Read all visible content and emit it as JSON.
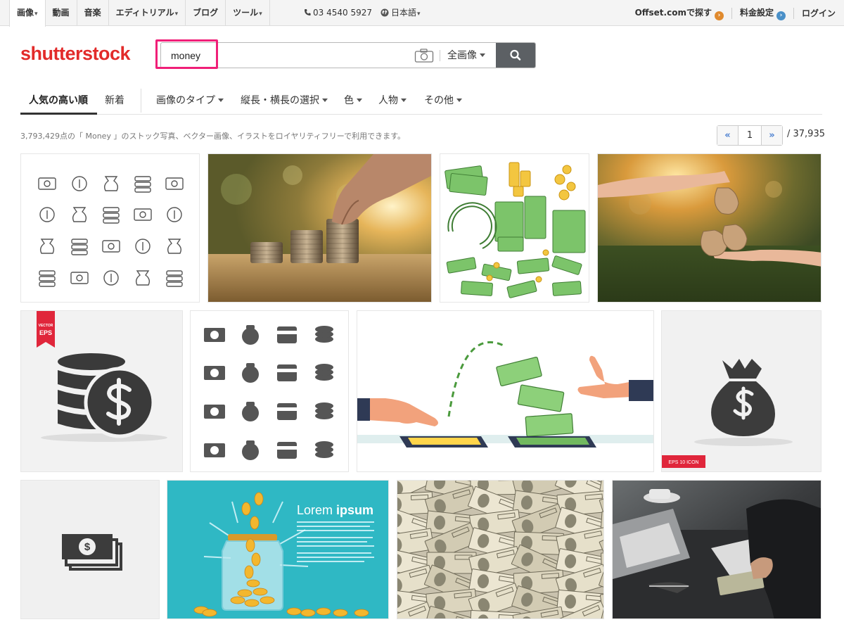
{
  "topbar": {
    "nav": [
      {
        "label": "画像",
        "has_menu": true,
        "active": true
      },
      {
        "label": "動画",
        "has_menu": false
      },
      {
        "label": "音楽",
        "has_menu": false
      },
      {
        "label": "エディトリアル",
        "has_menu": true
      },
      {
        "label": "ブログ",
        "has_menu": false
      },
      {
        "label": "ツール",
        "has_menu": true
      }
    ],
    "caret": "▾",
    "phone": "03 4540 5927",
    "language": "日本語",
    "offset_label": "Offset.comで探す",
    "pricing_label": "料金設定",
    "login_label": "ログイン"
  },
  "header": {
    "logo": "shutterstock",
    "search": {
      "value": "money",
      "placeholder": ""
    },
    "image_type": "全画像"
  },
  "filters": {
    "sort_popular": "人気の高い順",
    "sort_new": "新着",
    "image_type": "画像のタイプ",
    "orientation": "縦長・横長の選択",
    "color": "色",
    "people": "人物",
    "more": "その他"
  },
  "results": {
    "summary": "3,793,429点の「 Money 」のストック写真、ベクター画像、イラストをロイヤリティフリーで利用できます。",
    "page_prev": "«",
    "page_current": "1",
    "page_next": "»",
    "page_total": "/ 37,935"
  },
  "tiles": [
    {
      "name": "money-line-icons-image"
    },
    {
      "name": "coin-stacks-photo"
    },
    {
      "name": "cartoon-cash-and-coins-image"
    },
    {
      "name": "hands-money-bags-photo"
    },
    {
      "name": "coin-stack-dollar-icon-image",
      "badge_top": "VECTOR",
      "badge_bottom": "EPS"
    },
    {
      "name": "money-solid-icons-image"
    },
    {
      "name": "phone-payment-illustration"
    },
    {
      "name": "money-bag-icon-image",
      "badge": "EPS 10 ICON"
    },
    {
      "name": "banknotes-icon-image"
    },
    {
      "name": "coin-jar-lorem-ipsum-image",
      "text_light": "Lorem ",
      "text_bold": "ipsum"
    },
    {
      "name": "dollar-bills-pile-photo"
    },
    {
      "name": "businessman-counting-cash-photo"
    }
  ],
  "colors": {
    "brand": "#e22b2a",
    "highlight": "#f01f78",
    "link": "#4a7fd0",
    "offset_dot": "#e08a2e",
    "pricing_dot": "#4a90c8",
    "search_button": "#5c6064"
  }
}
